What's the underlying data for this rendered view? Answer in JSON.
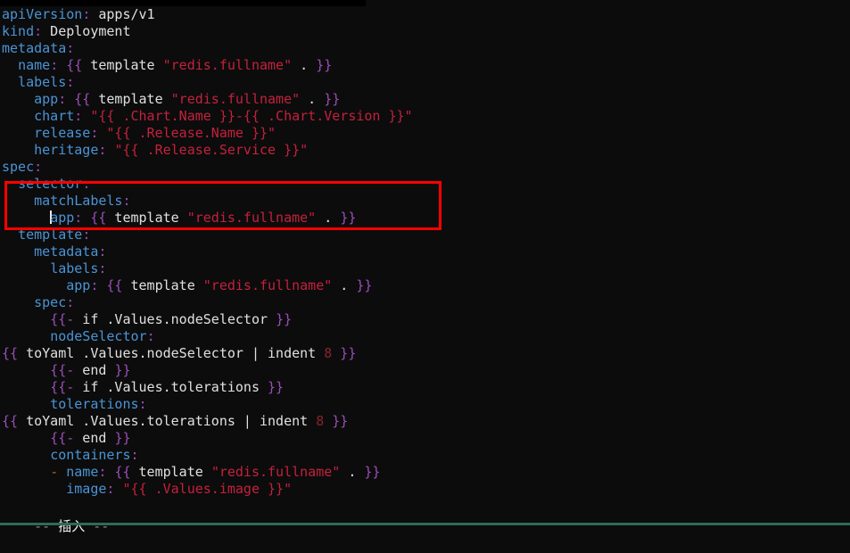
{
  "app": {
    "type": "terminal-text-editor",
    "editor": "vim",
    "mode_label": "-- 插入 --",
    "mode_dash_left": "--",
    "mode_dash_right": "--",
    "mode_text": "插入"
  },
  "colors": {
    "background": "#0c0c0c",
    "key": "#4a94d6",
    "punctuation": "#9b4fb8",
    "value": "#e0e0e0",
    "brace": "#9b4fb8",
    "string": "#c4213c",
    "number": "#8b2230",
    "list_dash": "#b5651d",
    "highlight_box": "#ff0000",
    "status_dim": "#8a8a8a",
    "bottom_rule": "#2e6b55"
  },
  "highlight_box": {
    "present": true,
    "color": "#ff0000",
    "covers_lines": [
      "selector:",
      "matchLabels:",
      "app: {{ template \"redis.fullname\" . }}"
    ]
  },
  "cursor": {
    "line_index": 13,
    "before_text": "app",
    "shape": "bar"
  },
  "buffer": {
    "filetype": "yaml",
    "lines": [
      {
        "id": "line-apiversion",
        "indent": "",
        "tokens": [
          {
            "t": "k",
            "s": "apiVersion"
          },
          {
            "t": "c",
            "s": ":"
          },
          {
            "t": "v",
            "s": " apps/v1"
          }
        ],
        "plain": "apiVersion: apps/v1"
      },
      {
        "id": "line-kind",
        "indent": "",
        "tokens": [
          {
            "t": "k",
            "s": "kind"
          },
          {
            "t": "c",
            "s": ":"
          },
          {
            "t": "v",
            "s": " Deployment"
          }
        ],
        "plain": "kind: Deployment"
      },
      {
        "id": "line-metadata",
        "indent": "",
        "tokens": [
          {
            "t": "k",
            "s": "metadata"
          },
          {
            "t": "c",
            "s": ":"
          }
        ],
        "plain": "metadata:"
      },
      {
        "id": "line-metadata-name",
        "indent": "  ",
        "tokens": [
          {
            "t": "k",
            "s": "name"
          },
          {
            "t": "c",
            "s": ":"
          },
          {
            "t": "v",
            "s": " "
          },
          {
            "t": "br",
            "s": "{{"
          },
          {
            "t": "v",
            "s": " template "
          },
          {
            "t": "str",
            "s": "\"redis.fullname\""
          },
          {
            "t": "v",
            "s": " . "
          },
          {
            "t": "br",
            "s": "}}"
          }
        ],
        "plain": "  name: {{ template \"redis.fullname\" . }}"
      },
      {
        "id": "line-metadata-labels",
        "indent": "  ",
        "tokens": [
          {
            "t": "k",
            "s": "labels"
          },
          {
            "t": "c",
            "s": ":"
          }
        ],
        "plain": "  labels:"
      },
      {
        "id": "line-labels-app",
        "indent": "    ",
        "tokens": [
          {
            "t": "k",
            "s": "app"
          },
          {
            "t": "c",
            "s": ":"
          },
          {
            "t": "v",
            "s": " "
          },
          {
            "t": "br",
            "s": "{{"
          },
          {
            "t": "v",
            "s": " template "
          },
          {
            "t": "str",
            "s": "\"redis.fullname\""
          },
          {
            "t": "v",
            "s": " . "
          },
          {
            "t": "br",
            "s": "}}"
          }
        ],
        "plain": "    app: {{ template \"redis.fullname\" . }}"
      },
      {
        "id": "line-labels-chart",
        "indent": "    ",
        "tokens": [
          {
            "t": "k",
            "s": "chart"
          },
          {
            "t": "c",
            "s": ":"
          },
          {
            "t": "v",
            "s": " "
          },
          {
            "t": "str",
            "s": "\"{{ .Chart.Name }}-{{ .Chart.Version }}\""
          }
        ],
        "plain": "    chart: \"{{ .Chart.Name }}-{{ .Chart.Version }}\""
      },
      {
        "id": "line-labels-release",
        "indent": "    ",
        "tokens": [
          {
            "t": "k",
            "s": "release"
          },
          {
            "t": "c",
            "s": ":"
          },
          {
            "t": "v",
            "s": " "
          },
          {
            "t": "str",
            "s": "\"{{ .Release.Name }}\""
          }
        ],
        "plain": "    release: \"{{ .Release.Name }}\""
      },
      {
        "id": "line-labels-heritage",
        "indent": "    ",
        "tokens": [
          {
            "t": "k",
            "s": "heritage"
          },
          {
            "t": "c",
            "s": ":"
          },
          {
            "t": "v",
            "s": " "
          },
          {
            "t": "str",
            "s": "\"{{ .Release.Service }}\""
          }
        ],
        "plain": "    heritage: \"{{ .Release.Service }}\""
      },
      {
        "id": "line-spec",
        "indent": "",
        "tokens": [
          {
            "t": "k",
            "s": "spec"
          },
          {
            "t": "c",
            "s": ":"
          }
        ],
        "plain": "spec:"
      },
      {
        "id": "line-selector",
        "indent": "  ",
        "tokens": [
          {
            "t": "k",
            "s": "selector"
          },
          {
            "t": "c",
            "s": ":"
          }
        ],
        "plain": "  selector:"
      },
      {
        "id": "line-matchlabels",
        "indent": "    ",
        "tokens": [
          {
            "t": "k",
            "s": "matchLabels"
          },
          {
            "t": "c",
            "s": ":"
          }
        ],
        "plain": "    matchLabels:"
      },
      {
        "id": "line-matchlabels-app",
        "indent": "      ",
        "cursor_before": true,
        "tokens": [
          {
            "t": "k",
            "s": "app"
          },
          {
            "t": "c",
            "s": ":"
          },
          {
            "t": "v",
            "s": " "
          },
          {
            "t": "br",
            "s": "{{"
          },
          {
            "t": "v",
            "s": " template "
          },
          {
            "t": "str",
            "s": "\"redis.fullname\""
          },
          {
            "t": "v",
            "s": " . "
          },
          {
            "t": "br",
            "s": "}}"
          }
        ],
        "plain": "      app: {{ template \"redis.fullname\" . }}"
      },
      {
        "id": "line-template",
        "indent": "  ",
        "tokens": [
          {
            "t": "k",
            "s": "template"
          },
          {
            "t": "c",
            "s": ":"
          }
        ],
        "plain": "  template:"
      },
      {
        "id": "line-tpl-metadata",
        "indent": "    ",
        "tokens": [
          {
            "t": "k",
            "s": "metadata"
          },
          {
            "t": "c",
            "s": ":"
          }
        ],
        "plain": "    metadata:"
      },
      {
        "id": "line-tpl-labels",
        "indent": "      ",
        "tokens": [
          {
            "t": "k",
            "s": "labels"
          },
          {
            "t": "c",
            "s": ":"
          }
        ],
        "plain": "      labels:"
      },
      {
        "id": "line-tpl-labels-app",
        "indent": "        ",
        "tokens": [
          {
            "t": "k",
            "s": "app"
          },
          {
            "t": "c",
            "s": ":"
          },
          {
            "t": "v",
            "s": " "
          },
          {
            "t": "br",
            "s": "{{"
          },
          {
            "t": "v",
            "s": " template "
          },
          {
            "t": "str",
            "s": "\"redis.fullname\""
          },
          {
            "t": "v",
            "s": " . "
          },
          {
            "t": "br",
            "s": "}}"
          }
        ],
        "plain": "        app: {{ template \"redis.fullname\" . }}"
      },
      {
        "id": "line-tpl-spec",
        "indent": "    ",
        "tokens": [
          {
            "t": "k",
            "s": "spec"
          },
          {
            "t": "c",
            "s": ":"
          }
        ],
        "plain": "    spec:"
      },
      {
        "id": "line-if-nodeselector",
        "indent": "      ",
        "tokens": [
          {
            "t": "br",
            "s": "{{-"
          },
          {
            "t": "v",
            "s": " if .Values.nodeSelector "
          },
          {
            "t": "br",
            "s": "}}"
          }
        ],
        "plain": "      {{- if .Values.nodeSelector }}"
      },
      {
        "id": "line-nodeselector-key",
        "indent": "      ",
        "tokens": [
          {
            "t": "k",
            "s": "nodeSelector"
          },
          {
            "t": "c",
            "s": ":"
          }
        ],
        "plain": "      nodeSelector:"
      },
      {
        "id": "line-toyaml-nodeselector",
        "indent": "",
        "tokens": [
          {
            "t": "br",
            "s": "{{"
          },
          {
            "t": "v",
            "s": " toYaml .Values.nodeSelector | indent "
          },
          {
            "t": "num",
            "s": "8"
          },
          {
            "t": "v",
            "s": " "
          },
          {
            "t": "br",
            "s": "}}"
          }
        ],
        "plain": "{{ toYaml .Values.nodeSelector | indent 8 }}"
      },
      {
        "id": "line-end-nodeselector",
        "indent": "      ",
        "tokens": [
          {
            "t": "br",
            "s": "{{-"
          },
          {
            "t": "v",
            "s": " end "
          },
          {
            "t": "br",
            "s": "}}"
          }
        ],
        "plain": "      {{- end }}"
      },
      {
        "id": "line-if-tolerations",
        "indent": "      ",
        "tokens": [
          {
            "t": "br",
            "s": "{{-"
          },
          {
            "t": "v",
            "s": " if .Values.tolerations "
          },
          {
            "t": "br",
            "s": "}}"
          }
        ],
        "plain": "      {{- if .Values.tolerations }}"
      },
      {
        "id": "line-tolerations-key",
        "indent": "      ",
        "tokens": [
          {
            "t": "k",
            "s": "tolerations"
          },
          {
            "t": "c",
            "s": ":"
          }
        ],
        "plain": "      tolerations:"
      },
      {
        "id": "line-toyaml-tolerations",
        "indent": "",
        "tokens": [
          {
            "t": "br",
            "s": "{{"
          },
          {
            "t": "v",
            "s": " toYaml .Values.tolerations | indent "
          },
          {
            "t": "num",
            "s": "8"
          },
          {
            "t": "v",
            "s": " "
          },
          {
            "t": "br",
            "s": "}}"
          }
        ],
        "plain": "{{ toYaml .Values.tolerations | indent 8 }}"
      },
      {
        "id": "line-end-tolerations",
        "indent": "      ",
        "tokens": [
          {
            "t": "br",
            "s": "{{-"
          },
          {
            "t": "v",
            "s": " end "
          },
          {
            "t": "br",
            "s": "}}"
          }
        ],
        "plain": "      {{- end }}"
      },
      {
        "id": "line-containers",
        "indent": "      ",
        "tokens": [
          {
            "t": "k",
            "s": "containers"
          },
          {
            "t": "c",
            "s": ":"
          }
        ],
        "plain": "      containers:"
      },
      {
        "id": "line-container-name",
        "indent": "      ",
        "tokens": [
          {
            "t": "dash",
            "s": "-"
          },
          {
            "t": "v",
            "s": " "
          },
          {
            "t": "k",
            "s": "name"
          },
          {
            "t": "c",
            "s": ":"
          },
          {
            "t": "v",
            "s": " "
          },
          {
            "t": "br",
            "s": "{{"
          },
          {
            "t": "v",
            "s": " template "
          },
          {
            "t": "str",
            "s": "\"redis.fullname\""
          },
          {
            "t": "v",
            "s": " . "
          },
          {
            "t": "br",
            "s": "}}"
          }
        ],
        "plain": "      - name: {{ template \"redis.fullname\" . }}"
      },
      {
        "id": "line-container-image",
        "indent": "        ",
        "tokens": [
          {
            "t": "k",
            "s": "image"
          },
          {
            "t": "c",
            "s": ":"
          },
          {
            "t": "v",
            "s": " "
          },
          {
            "t": "str",
            "s": "\"{{ .Values.image }}\""
          }
        ],
        "plain": "        image: \"{{ .Values.image }}\""
      }
    ]
  }
}
